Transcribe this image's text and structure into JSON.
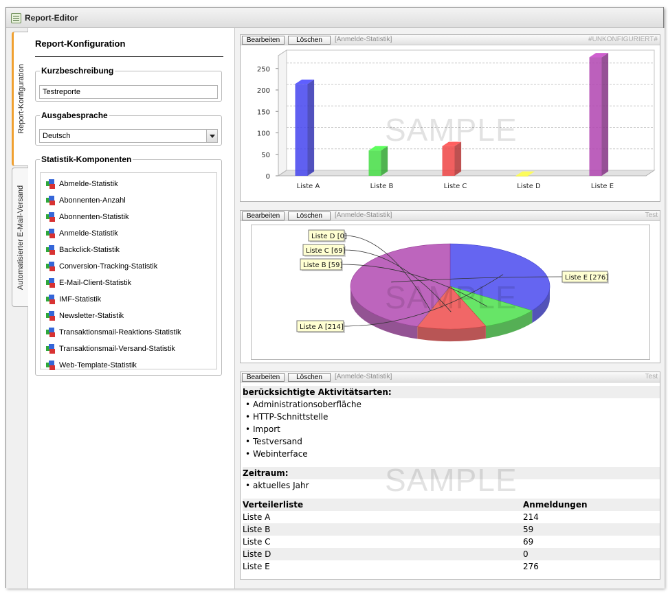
{
  "app": {
    "title": "Report-Editor"
  },
  "vertical_tabs": [
    "Report-Konfiguration",
    "Automatisierter E-Mail-Versand"
  ],
  "config": {
    "title": "Report-Konfiguration",
    "kurz_label": "Kurzbeschreibung",
    "kurz_value": "Testreporte",
    "sprache_label": "Ausgabesprache",
    "sprache_value": "Deutsch",
    "komp_label": "Statistik-Komponenten",
    "components": [
      "Abmelde-Statistik",
      "Abonnenten-Anzahl",
      "Abonnenten-Statistik",
      "Anmelde-Statistik",
      "Backclick-Statistik",
      "Conversion-Tracking-Statistik",
      "E-Mail-Client-Statistik",
      "IMF-Statistik",
      "Newsletter-Statistik",
      "Transaktionsmail-Reaktions-Statistik",
      "Transaktionsmail-Versand-Statistik",
      "Web-Template-Statistik"
    ]
  },
  "panels": {
    "edit_label": "Bearbeiten",
    "delete_label": "Löschen",
    "p1": {
      "name": "[Anmelde-Statistik]",
      "tag": "#UNKONFIGURIERT#"
    },
    "p2": {
      "name": "[Anmelde-Statistik]",
      "tag": "Test"
    },
    "p3": {
      "name": "[Anmelde-Statistik]",
      "tag": "Test"
    },
    "watermark": "SAMPLE"
  },
  "chart_data": [
    {
      "type": "bar",
      "categories": [
        "Liste A",
        "Liste B",
        "Liste C",
        "Liste D",
        "Liste E"
      ],
      "values": [
        214,
        59,
        69,
        0,
        276
      ],
      "colors": [
        "#4444ee",
        "#44dd44",
        "#ee4444",
        "#eeee44",
        "#b044b0"
      ],
      "ylim": [
        0,
        280
      ],
      "yticks": [
        0,
        50,
        100,
        150,
        200,
        250
      ],
      "grid": true
    },
    {
      "type": "pie",
      "categories": [
        "Liste A",
        "Liste B",
        "Liste C",
        "Liste D",
        "Liste E"
      ],
      "values": [
        214,
        59,
        69,
        0,
        276
      ],
      "labels": [
        "Liste A [214]",
        "Liste B [59]",
        "Liste C [69]",
        "Liste D [0]",
        "Liste E [276]"
      ],
      "colors": [
        "#4a4aee",
        "#4ce04c",
        "#ee4c4c",
        "#eeee44",
        "#b24ab2"
      ]
    }
  ],
  "stats": {
    "aktiv_header": "berücksichtigte Aktivitätsarten:",
    "aktiv": [
      "Administrationsoberfläche",
      "HTTP-Schnittstelle",
      "Import",
      "Testversand",
      "Webinterface"
    ],
    "zeitraum_header": "Zeitraum:",
    "zeitraum": [
      "aktuelles Jahr"
    ],
    "table_headers": [
      "Verteilerliste",
      "Anmeldungen"
    ],
    "rows": [
      [
        "Liste A",
        "214"
      ],
      [
        "Liste B",
        "59"
      ],
      [
        "Liste C",
        "69"
      ],
      [
        "Liste D",
        "0"
      ],
      [
        "Liste E",
        "276"
      ]
    ]
  }
}
